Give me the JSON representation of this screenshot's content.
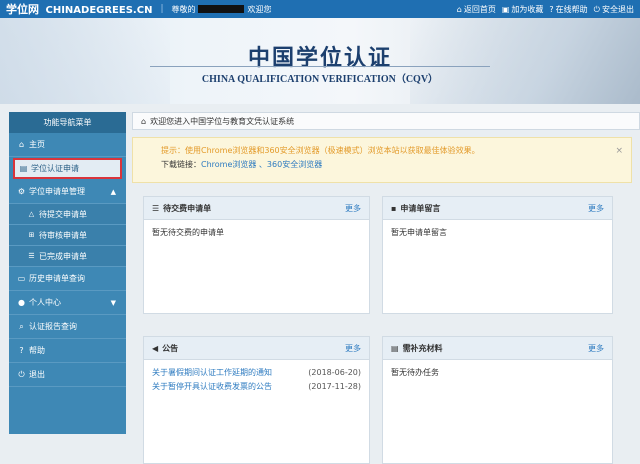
{
  "topbar": {
    "logo_cn": "学位网",
    "logo_en": "CHINADEGREES.CN",
    "welcome_prefix": "尊敬的",
    "welcome_suffix": "欢迎您",
    "links": [
      "返回首页",
      "加为收藏",
      "在线帮助",
      "安全退出"
    ],
    "link_icons": [
      "home-icon",
      "bookmark-icon",
      "help-icon",
      "power-icon"
    ]
  },
  "banner": {
    "title": "中国学位认证",
    "subtitle": "CHINA QUALIFICATION VERIFICATION（CQV）"
  },
  "sidebar": {
    "header": "功能导航菜单",
    "items": [
      {
        "label": "主页",
        "icon": "home-icon"
      },
      {
        "label": "学位认证申请",
        "icon": "document-icon"
      },
      {
        "label": "学位申请单管理",
        "icon": "gear-icon"
      },
      {
        "label": "待提交申请单",
        "icon": "warning-icon"
      },
      {
        "label": "待审核申请单",
        "icon": "cart-icon"
      },
      {
        "label": "已完成申请单",
        "icon": "list-icon"
      },
      {
        "label": "历史申请单查询",
        "icon": "folder-icon"
      },
      {
        "label": "个人中心",
        "icon": "user-icon"
      },
      {
        "label": "认证报告查询",
        "icon": "search-icon"
      },
      {
        "label": "帮助",
        "icon": "help-icon"
      },
      {
        "label": "退出",
        "icon": "power-icon"
      }
    ]
  },
  "welcome_bar": "欢迎您进入中国学位与教育文凭认证系统",
  "notice": {
    "line1": "提示：使用Chrome浏览器和360安全浏览器（极速模式）浏览本站以获取最佳体验效果。",
    "line2_prefix": "下载链接：",
    "line2_links": "Chrome浏览器 、360安全浏览器"
  },
  "panels": {
    "pending": {
      "title": "待交费申请单",
      "more": "更多",
      "body": "暂无待交费的申请单"
    },
    "messages": {
      "title": "申请单留言",
      "more": "更多",
      "body": "暂无申请单留言"
    },
    "announcements": {
      "title": "公告",
      "more": "更多",
      "items": [
        {
          "text": "关于暑假期间认证工作延期的通知",
          "date": "(2018-06-20)"
        },
        {
          "text": "关于暂停开具认证收费发票的公告",
          "date": "(2017-11-28)"
        }
      ]
    },
    "supplement": {
      "title": "需补充材料",
      "more": "更多",
      "body": "暂无待办任务"
    }
  },
  "colors": {
    "topbar": "#1f6fb2",
    "sidebar": "#3e88b5",
    "highlight_border": "#d9343b",
    "link": "#2e7bc0"
  }
}
